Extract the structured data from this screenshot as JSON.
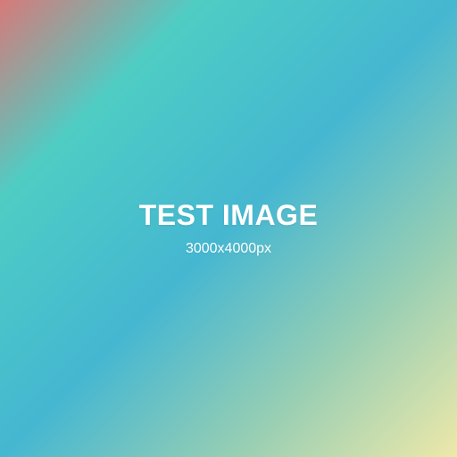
{
  "image": {
    "title": "TEST IMAGE",
    "subtitle": "3000x4000px"
  },
  "colors": {
    "gradient_top_left": "#d77a79",
    "gradient_upper": "#4ecdc4",
    "gradient_middle": "#45b7d1",
    "gradient_lower": "#96ceb4",
    "gradient_bottom_right": "#eee8a9",
    "text": "#ffffff"
  }
}
